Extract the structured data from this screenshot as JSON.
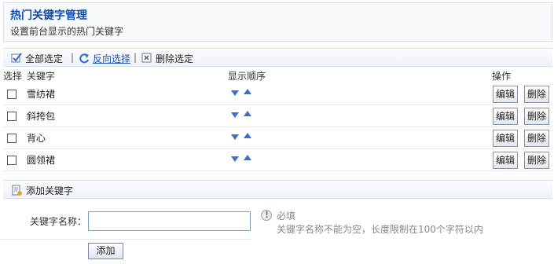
{
  "header": {
    "title": "热门关键字管理",
    "subtitle": "设置前台显示的热门关键字"
  },
  "toolbar": {
    "select_all": "全部选定",
    "invert_selection": "反向选择",
    "delete_selected": "删除选定",
    "separator": "|"
  },
  "table": {
    "headers": {
      "select": "选择",
      "keyword": "关键字",
      "order": "显示顺序",
      "actions": "操作"
    },
    "rows": [
      {
        "keyword": "雪纺裙",
        "edit": "编辑",
        "delete": "删除"
      },
      {
        "keyword": "斜挎包",
        "edit": "编辑",
        "delete": "删除"
      },
      {
        "keyword": "背心",
        "edit": "编辑",
        "delete": "删除"
      },
      {
        "keyword": "圆领裙",
        "edit": "编辑",
        "delete": "删除"
      }
    ]
  },
  "add_section": {
    "title": "添加关键字",
    "label": "关键字名称：",
    "input_value": "",
    "required": "必填",
    "hint": "关键字名称不能为空，长度限制在100个字符以内",
    "submit": "添加"
  },
  "colors": {
    "title": "#0f4db3",
    "link": "#1a53b8",
    "arrow": "#3b6fd0"
  }
}
